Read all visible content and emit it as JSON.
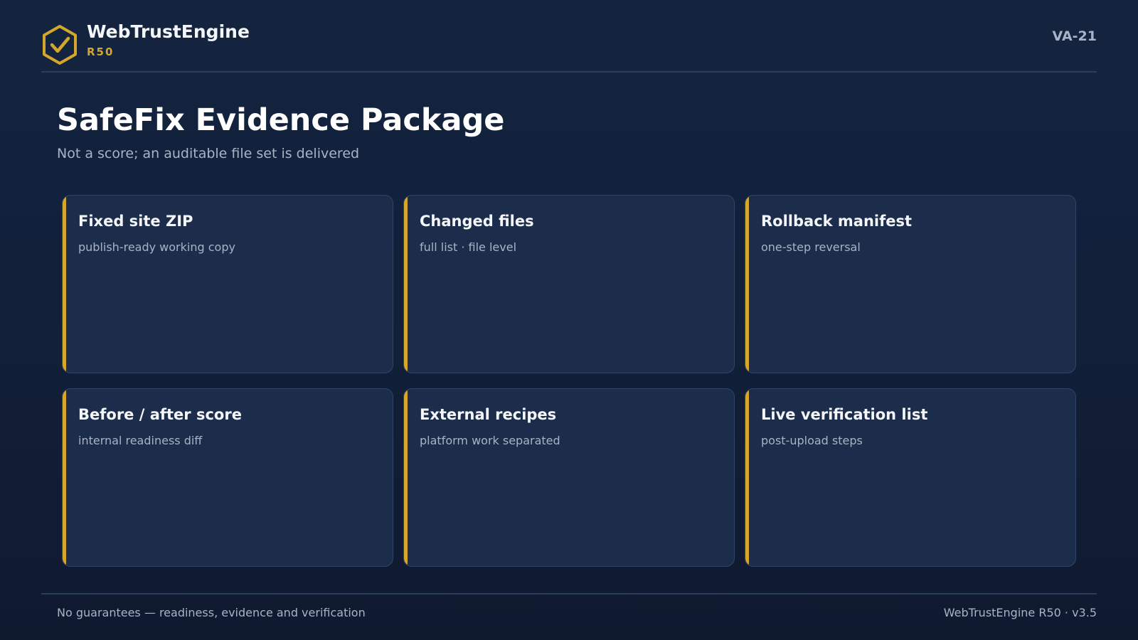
{
  "header": {
    "brand_name": "WebTrustEngine",
    "brand_sub": "R50",
    "doc_code": "VA-21",
    "logo_icon": "hexagon-check-icon"
  },
  "page": {
    "title": "SafeFix Evidence Package",
    "subtitle": "Not a score; an auditable file set is delivered"
  },
  "cards": [
    {
      "title": "Fixed site ZIP",
      "desc": "publish-ready working copy"
    },
    {
      "title": "Changed files",
      "desc": "full list · file level"
    },
    {
      "title": "Rollback manifest",
      "desc": "one-step reversal"
    },
    {
      "title": "Before / after score",
      "desc": "internal readiness diff"
    },
    {
      "title": "External recipes",
      "desc": "platform work separated"
    },
    {
      "title": "Live verification list",
      "desc": "post-upload steps"
    }
  ],
  "footer": {
    "left": "No guarantees — readiness, evidence and verification",
    "right": "WebTrustEngine R50 · v3.5"
  },
  "colors": {
    "background": "#12203a",
    "card": "#1b2d4a",
    "accent": "#d4a72c",
    "muted_text": "#a8b3c5"
  }
}
